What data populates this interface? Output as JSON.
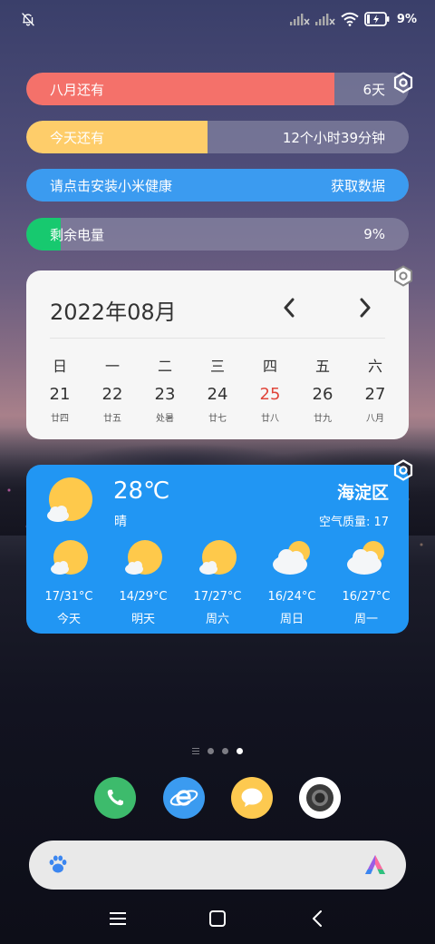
{
  "status_bar": {
    "battery_percent": "9%",
    "icons": [
      "bell-off-icon",
      "signal-icon",
      "signal-icon",
      "wifi-icon",
      "battery-charging-icon"
    ]
  },
  "widgets": {
    "month_left": {
      "label": "八月还有",
      "value": "6天",
      "fill_fraction": 0.806,
      "color": "#f4716a"
    },
    "day_left": {
      "label": "今天还有",
      "value": "12个小时39分钟",
      "fill_fraction": 0.473,
      "color": "#fecd6a"
    },
    "health": {
      "label": "请点击安装小米健康",
      "value": "获取数据",
      "color": "#3b9bf0"
    },
    "battery": {
      "label": "剩余电量",
      "value": "9%",
      "fill_fraction": 0.09,
      "color": "#17c96f"
    }
  },
  "calendar": {
    "title": "2022年08月",
    "weekdays": [
      "日",
      "一",
      "二",
      "三",
      "四",
      "五",
      "六"
    ],
    "days": [
      {
        "day": "21",
        "lunar": "廿四"
      },
      {
        "day": "22",
        "lunar": "廿五"
      },
      {
        "day": "23",
        "lunar": "处暑"
      },
      {
        "day": "24",
        "lunar": "廿七"
      },
      {
        "day": "25",
        "lunar": "廿八",
        "today": true
      },
      {
        "day": "26",
        "lunar": "廿九"
      },
      {
        "day": "27",
        "lunar": "八月"
      }
    ],
    "today_color": "#e0453a"
  },
  "weather": {
    "temp": "28℃",
    "condition": "晴",
    "location": "海淀区",
    "aqi": "空气质量: 17",
    "forecast": [
      {
        "temp": "17/31°C",
        "day": "今天",
        "icon": "sunny-cloud-icon"
      },
      {
        "temp": "14/29°C",
        "day": "明天",
        "icon": "sunny-cloud-icon"
      },
      {
        "temp": "17/27°C",
        "day": "周六",
        "icon": "sunny-cloud-icon"
      },
      {
        "temp": "16/24°C",
        "day": "周日",
        "icon": "cloudy-sun-icon"
      },
      {
        "temp": "16/27°C",
        "day": "周一",
        "icon": "cloudy-sun-icon"
      }
    ],
    "background_color": "#2196f3"
  },
  "page_indicator": {
    "pages": 3,
    "active_index": 2
  },
  "dock": [
    "phone-app-icon",
    "browser-app-icon",
    "messages-app-icon",
    "camera-app-icon"
  ],
  "colors": {
    "phone": "#3dbb6c",
    "browser": "#3b9bf0",
    "messages": "#fdc950",
    "camera": "#ffffff"
  }
}
